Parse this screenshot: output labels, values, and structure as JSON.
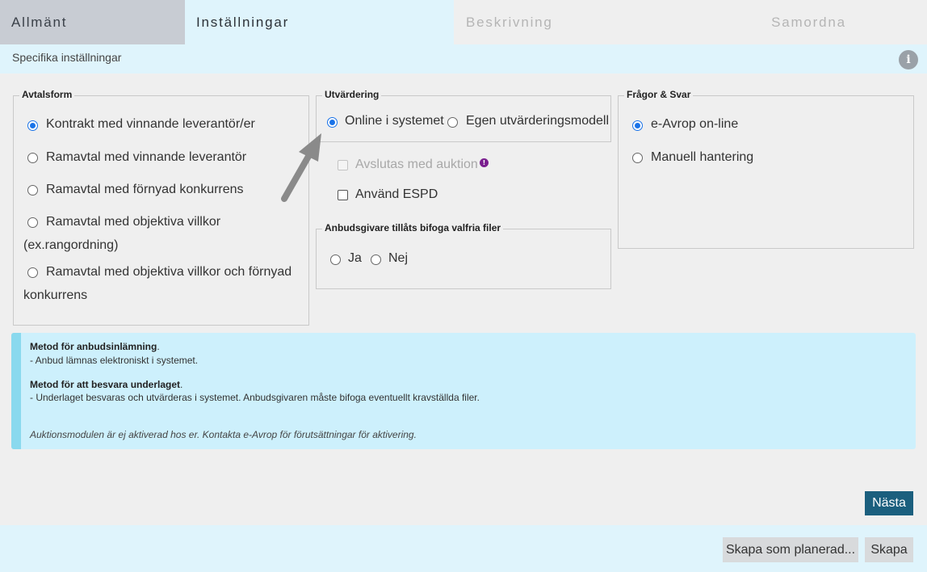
{
  "tabs": [
    {
      "label": "Allmänt"
    },
    {
      "label": "Inställningar"
    },
    {
      "label": "Beskrivning"
    },
    {
      "label": "Samordna"
    }
  ],
  "subheader": {
    "title": "Specifika inställningar",
    "info_icon": "i"
  },
  "avtalsform": {
    "legend": "Avtalsform",
    "options": [
      {
        "label": "Kontrakt med vinnande leverantör/er",
        "checked": true
      },
      {
        "label": "Ramavtal med vinnande leverantör",
        "checked": false
      },
      {
        "label": "Ramavtal med förnyad konkurrens",
        "checked": false
      },
      {
        "label": "Ramavtal med objektiva villkor",
        "label2": "(ex.rangordning)",
        "checked": false
      },
      {
        "label": "Ramavtal med objektiva villkor och förnyad",
        "label2": "konkurrens",
        "checked": false
      }
    ]
  },
  "utvardering": {
    "legend": "Utvärdering",
    "options": [
      {
        "label": "Online i systemet",
        "checked": true
      },
      {
        "label": "Egen utvärderingsmodell",
        "checked": false
      }
    ],
    "auction_label": "Avslutas med auktion",
    "auction_icon": "!",
    "espd_label": "Använd ESPD"
  },
  "bifoga": {
    "legend": "Anbudsgivare tillåts bifoga valfria filer",
    "options": [
      {
        "label": "Ja",
        "checked": false
      },
      {
        "label": "Nej",
        "checked": false
      }
    ]
  },
  "fragor": {
    "legend": "Frågor & Svar",
    "options": [
      {
        "label": "e-Avrop on-line",
        "checked": true
      },
      {
        "label": "Manuell hantering",
        "checked": false
      }
    ]
  },
  "info": {
    "h1": "Metod för anbudsinlämning",
    "p1": "- Anbud lämnas elektroniskt i systemet.",
    "h2": "Metod för att besvara underlaget",
    "p2": "- Underlaget besvaras och utvärderas i systemet. Anbudsgivaren måste bifoga eventuellt kravställda filer.",
    "note": "Auktionsmodulen är ej aktiverad hos er. Kontakta e-Avrop för förutsättningar för aktivering.",
    "period": "."
  },
  "buttons": {
    "next": "Nästa",
    "create_planned": "Skapa som planerad...",
    "create": "Skapa"
  },
  "colors": {
    "accent": "#1b5f7e",
    "radio_checked": "#1a73e8",
    "info_bg": "#cdf0fc",
    "info_border": "#8ad9ee"
  }
}
